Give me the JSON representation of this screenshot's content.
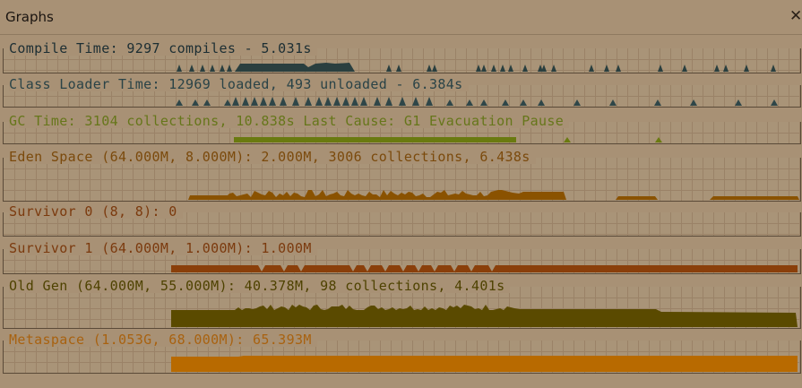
{
  "window": {
    "title": "Graphs",
    "close_icon": "close-icon"
  },
  "panels": [
    {
      "id": "compile-time",
      "label": "Compile Time: 9297 compiles - 5.031s",
      "color": "#2a3f3f"
    },
    {
      "id": "class-loader-time",
      "label": "Class Loader Time: 12969 loaded, 493 unloaded - 6.384s",
      "color": "#2f4648"
    },
    {
      "id": "gc-time",
      "label": "GC Time: 3104 collections, 10.838s  Last Cause: G1 Evacuation Pause",
      "color": "#6a7a10"
    },
    {
      "id": "eden-space",
      "label": "Eden Space (64.000M, 8.000M): 2.000M, 3006 collections, 6.438s",
      "color": "#8a5200"
    },
    {
      "id": "survivor-0",
      "label": "Survivor 0 (8, 8): 0",
      "color": "#8a3f0a"
    },
    {
      "id": "survivor-1",
      "label": "Survivor 1 (64.000M, 1.000M): 1.000M",
      "color": "#8a3f0a"
    },
    {
      "id": "old-gen",
      "label": "Old Gen (64.000M, 55.000M): 40.378M, 98 collections, 4.401s",
      "color": "#5a4a00"
    },
    {
      "id": "metaspace",
      "label": "Metaspace (1.053G, 68.000M): 65.393M",
      "color": "#b86a00"
    }
  ],
  "colors": {
    "background": "#a89175",
    "grid": "#9a8267",
    "border": "#5a4a38",
    "compile": "#2a3f3f",
    "class_loader": "#2f4648",
    "gc": "#6a7a10",
    "eden": "#8a5200",
    "survivor1": "#8a3f0a",
    "old_gen": "#5a4a00",
    "metaspace": "#b86a00"
  }
}
